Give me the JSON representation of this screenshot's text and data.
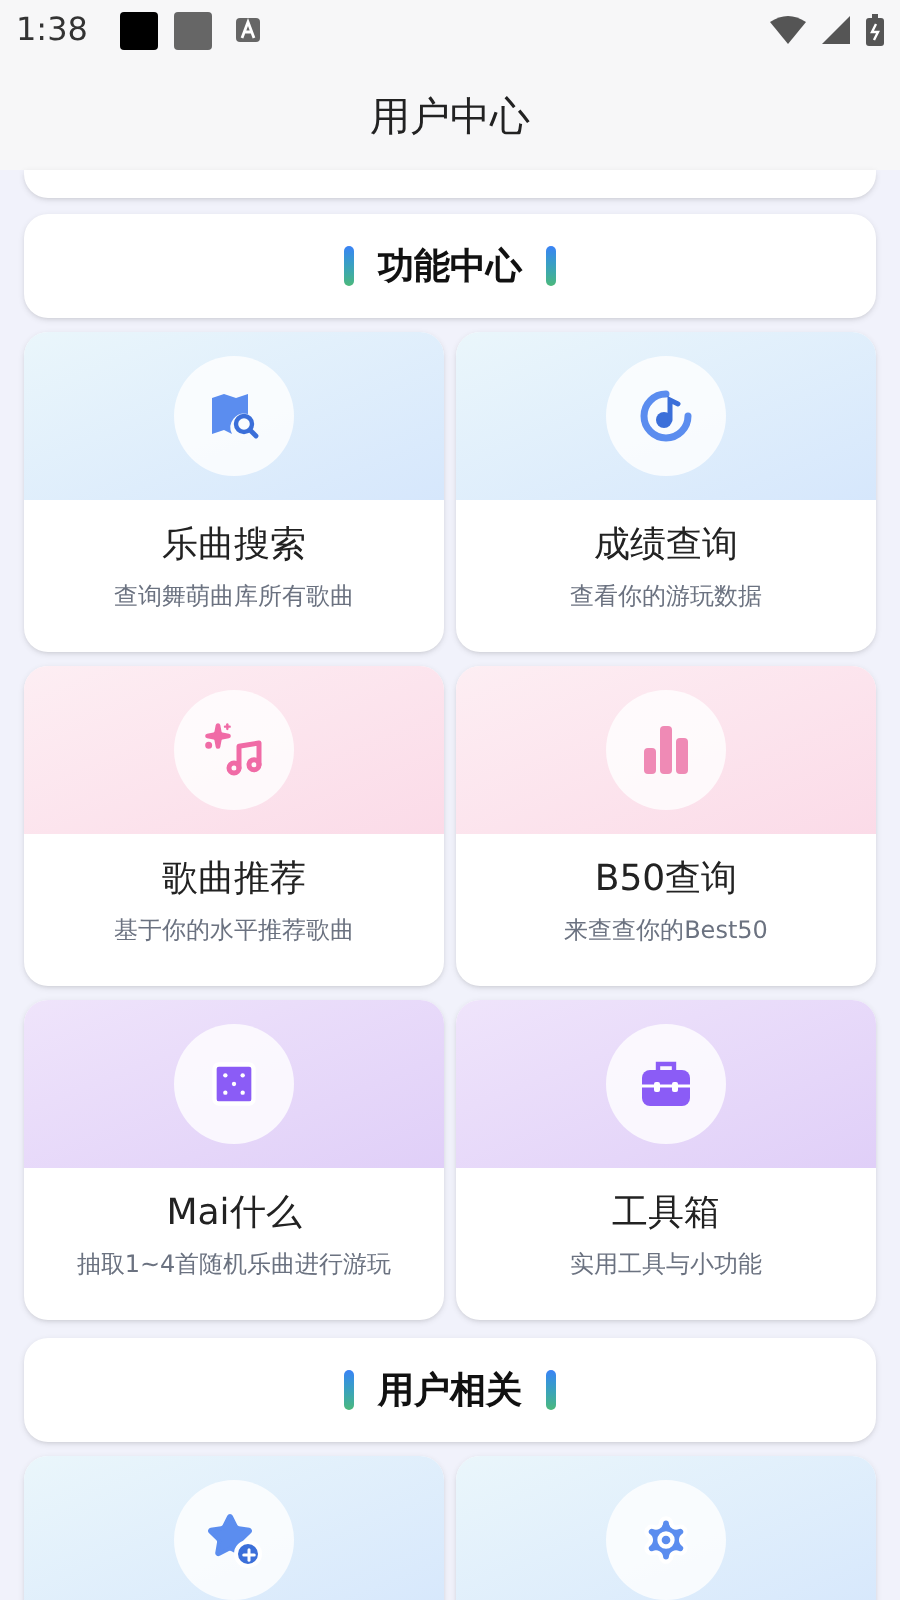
{
  "status_bar": {
    "time": "1:38"
  },
  "header": {
    "title": "用户中心"
  },
  "sections": [
    {
      "title": "功能中心",
      "cards": [
        {
          "kind": "search",
          "title": "乐曲搜索",
          "subtitle": "查询舞萌曲库所有歌曲"
        },
        {
          "kind": "scores",
          "title": "成绩查询",
          "subtitle": "查看你的游玩数据"
        },
        {
          "kind": "recommend",
          "title": "歌曲推荐",
          "subtitle": "基于你的水平推荐歌曲"
        },
        {
          "kind": "best",
          "title": "B50查询",
          "subtitle": "来查查你的Best50"
        },
        {
          "kind": "random",
          "title": "Mai什么",
          "subtitle": "抽取1~4首随机乐曲进行游玩"
        },
        {
          "kind": "tools",
          "title": "工具箱",
          "subtitle": "实用工具与小功能"
        }
      ]
    },
    {
      "title": "用户相关",
      "cards": [
        {
          "kind": "favorites"
        },
        {
          "kind": "settings"
        }
      ]
    }
  ]
}
